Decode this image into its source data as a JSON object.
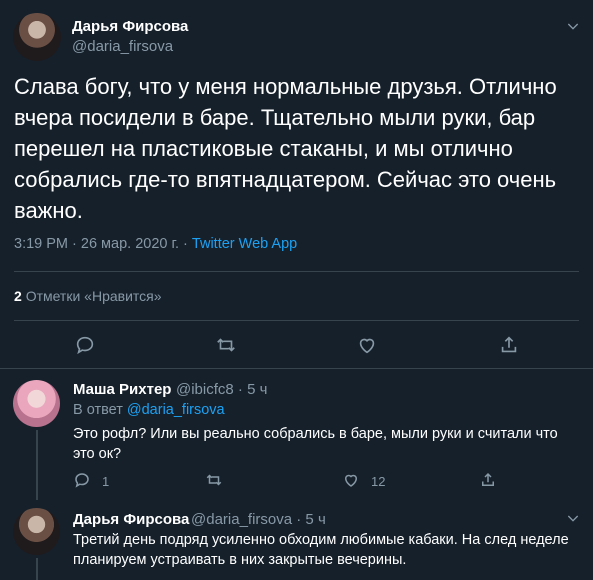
{
  "colors": {
    "background": "#15202b",
    "accent": "#1da1f2",
    "muted": "#8899a6",
    "divider": "#38444d"
  },
  "main_tweet": {
    "author_name": "Дарья Фирсова",
    "author_handle": "@daria_firsova",
    "text": "Слава богу, что у меня нормальные друзья. Отлично вчера посидели в баре. Тщательно мыли руки, бар перешел на пластиковые стаканы, и мы отлично собрались где-то впятнадцатером. Сейчас это очень важно.",
    "timestamp": "3:19 PM · 26 мар. 2020 г. · ",
    "source": "Twitter Web App",
    "likes_count": "2",
    "likes_label": "Отметки «Нравится»",
    "icons": [
      "reply-icon",
      "retweet-icon",
      "like-icon",
      "share-icon"
    ]
  },
  "replies": [
    {
      "author_name": "Маша Рихтер",
      "author_handle": "@ibicfc8 · 5 ч",
      "replying_prefix": "В ответ ",
      "replying_to": "@daria_firsova",
      "text": "Это рофл? Или вы реально собрались в баре, мыли руки и считали что это ок?",
      "reply_count": "1",
      "like_count": "12"
    },
    {
      "author_name": "Дарья Фирсова",
      "author_handle": "@daria_firsova · 5 ч",
      "text": "Третий день подряд усиленно обходим любимые кабаки. На след неделе планируем устраивать в них закрытые вечерины."
    }
  ]
}
